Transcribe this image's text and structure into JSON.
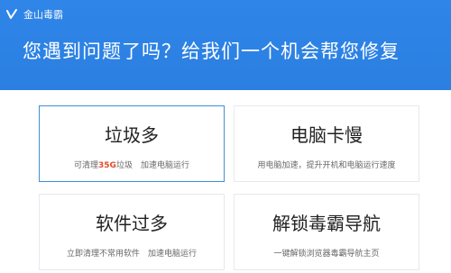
{
  "app": {
    "title": "金山毒霸",
    "logo_icon": "v-check-logo"
  },
  "headline": "您遇到问题了吗？给我们一个机会帮您修复",
  "colors": {
    "header": "#2b7fe1",
    "accent_border": "#3e8fd6",
    "highlight": "#e24b2a"
  },
  "cards": [
    {
      "title": "垃圾多",
      "desc_prefix": "可清理",
      "desc_highlight": "35G",
      "desc_suffix": "垃圾　加速电脑运行"
    },
    {
      "title": "电脑卡慢",
      "desc": "用电脑加速，提升开机和电脑运行速度"
    },
    {
      "title": "软件过多",
      "desc": "立即清理不常用软件　加速电脑运行"
    },
    {
      "title": "解锁毒霸导航",
      "desc": "一键解锁浏览器毒霸导航主页"
    }
  ]
}
